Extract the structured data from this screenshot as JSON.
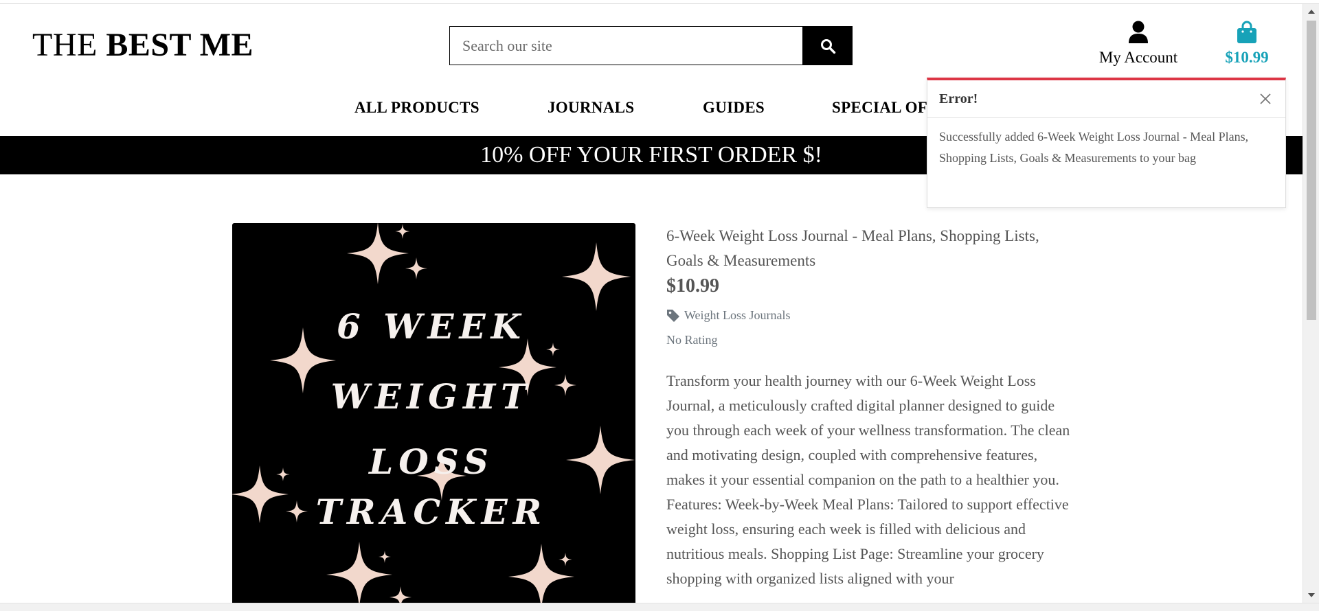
{
  "header": {
    "logo_prefix": "THE",
    "logo_bold": "BEST ME",
    "search_placeholder": "Search our site",
    "account_label": "My Account",
    "bag_total": "$10.99"
  },
  "nav": {
    "items": [
      "ALL PRODUCTS",
      "JOURNALS",
      "GUIDES",
      "SPECIAL OF"
    ]
  },
  "banner": {
    "text": "10% OFF YOUR FIRST ORDER $!"
  },
  "product": {
    "image_text_lines": [
      "6 WEEK",
      "WEIGHT",
      "LOSS",
      "TRACKER"
    ],
    "title": "6-Week Weight Loss Journal - Meal Plans, Shopping Lists, Goals & Measurements",
    "price": "$10.99",
    "category": "Weight Loss Journals",
    "rating": "No Rating",
    "description": "Transform your health journey with our 6-Week Weight Loss Journal, a meticulously crafted digital planner designed to guide you through each week of your wellness transformation. The clean and motivating design, coupled with comprehensive features, makes it your essential companion on the path to a healthier you. Features: Week-by-Week Meal Plans: Tailored to support effective weight loss, ensuring each week is filled with delicious and nutritious meals. Shopping List Page: Streamline your grocery shopping with organized lists aligned with your"
  },
  "toast": {
    "title": "Error!",
    "message": "Successfully added 6-Week Weight Loss Journal - Meal Plans, Shopping Lists, Goals & Measurements to your bag"
  },
  "colors": {
    "accent": "#17a2b8",
    "toast_border": "#dc3545",
    "sparkle": "#f2d8cc",
    "banner_bg": "#000000"
  }
}
